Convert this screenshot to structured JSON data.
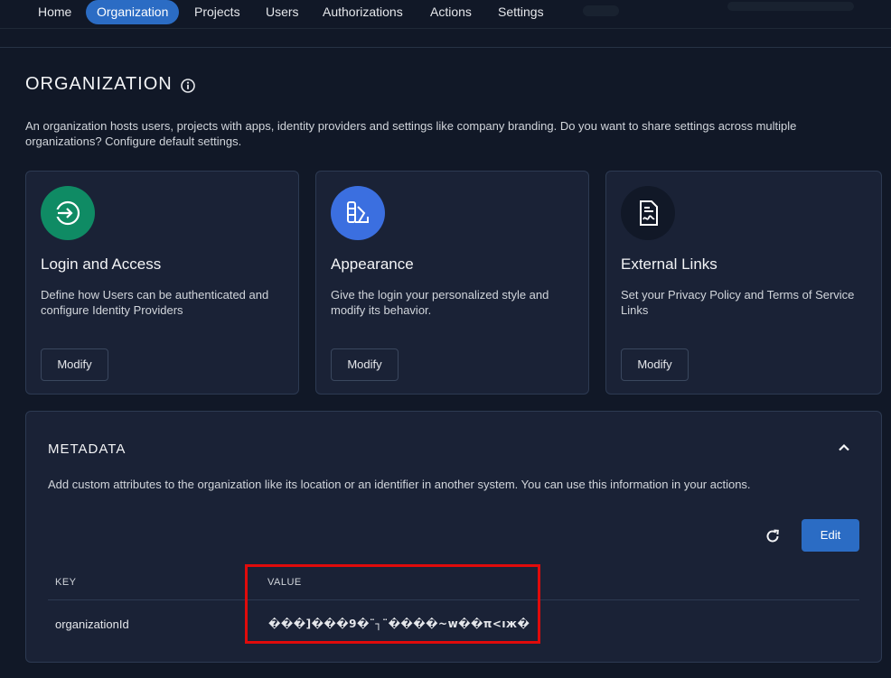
{
  "nav": {
    "items": [
      {
        "label": "Home",
        "active": false
      },
      {
        "label": "Organization",
        "active": true
      },
      {
        "label": "Projects",
        "active": false
      },
      {
        "label": "Users",
        "active": false
      },
      {
        "label": "Authorizations",
        "active": false
      },
      {
        "label": "Actions",
        "active": false
      },
      {
        "label": "Settings",
        "active": false
      }
    ]
  },
  "page": {
    "title": "ORGANIZATION",
    "description": "An organization hosts users, projects with apps, identity providers and settings like company branding. Do you want to share settings across multiple organizations? Configure default settings."
  },
  "cards": [
    {
      "title": "Login and Access",
      "description": "Define how Users can be authenticated and configure Identity Providers",
      "button": "Modify",
      "icon": "login-icon",
      "icon_color": "#0f8b64"
    },
    {
      "title": "Appearance",
      "description": "Give the login your personalized style and modify its behavior.",
      "button": "Modify",
      "icon": "palette-icon",
      "icon_color": "#3b6fe0"
    },
    {
      "title": "External Links",
      "description": "Set your Privacy Policy and Terms of Service Links",
      "button": "Modify",
      "icon": "document-icon",
      "icon_color": "#111827"
    }
  ],
  "metadata": {
    "title": "METADATA",
    "description": "Add custom attributes to the organization like its location or an identifier in another system. You can use this information in your actions.",
    "edit_label": "Edit",
    "columns": {
      "key": "KEY",
      "value": "VALUE"
    },
    "rows": [
      {
        "key": "organizationId",
        "value": "���]���9�¨┐¨����~w��π<ıж�"
      }
    ]
  },
  "colors": {
    "accent": "#2b6cc4",
    "highlight_border": "#e00b0b"
  }
}
